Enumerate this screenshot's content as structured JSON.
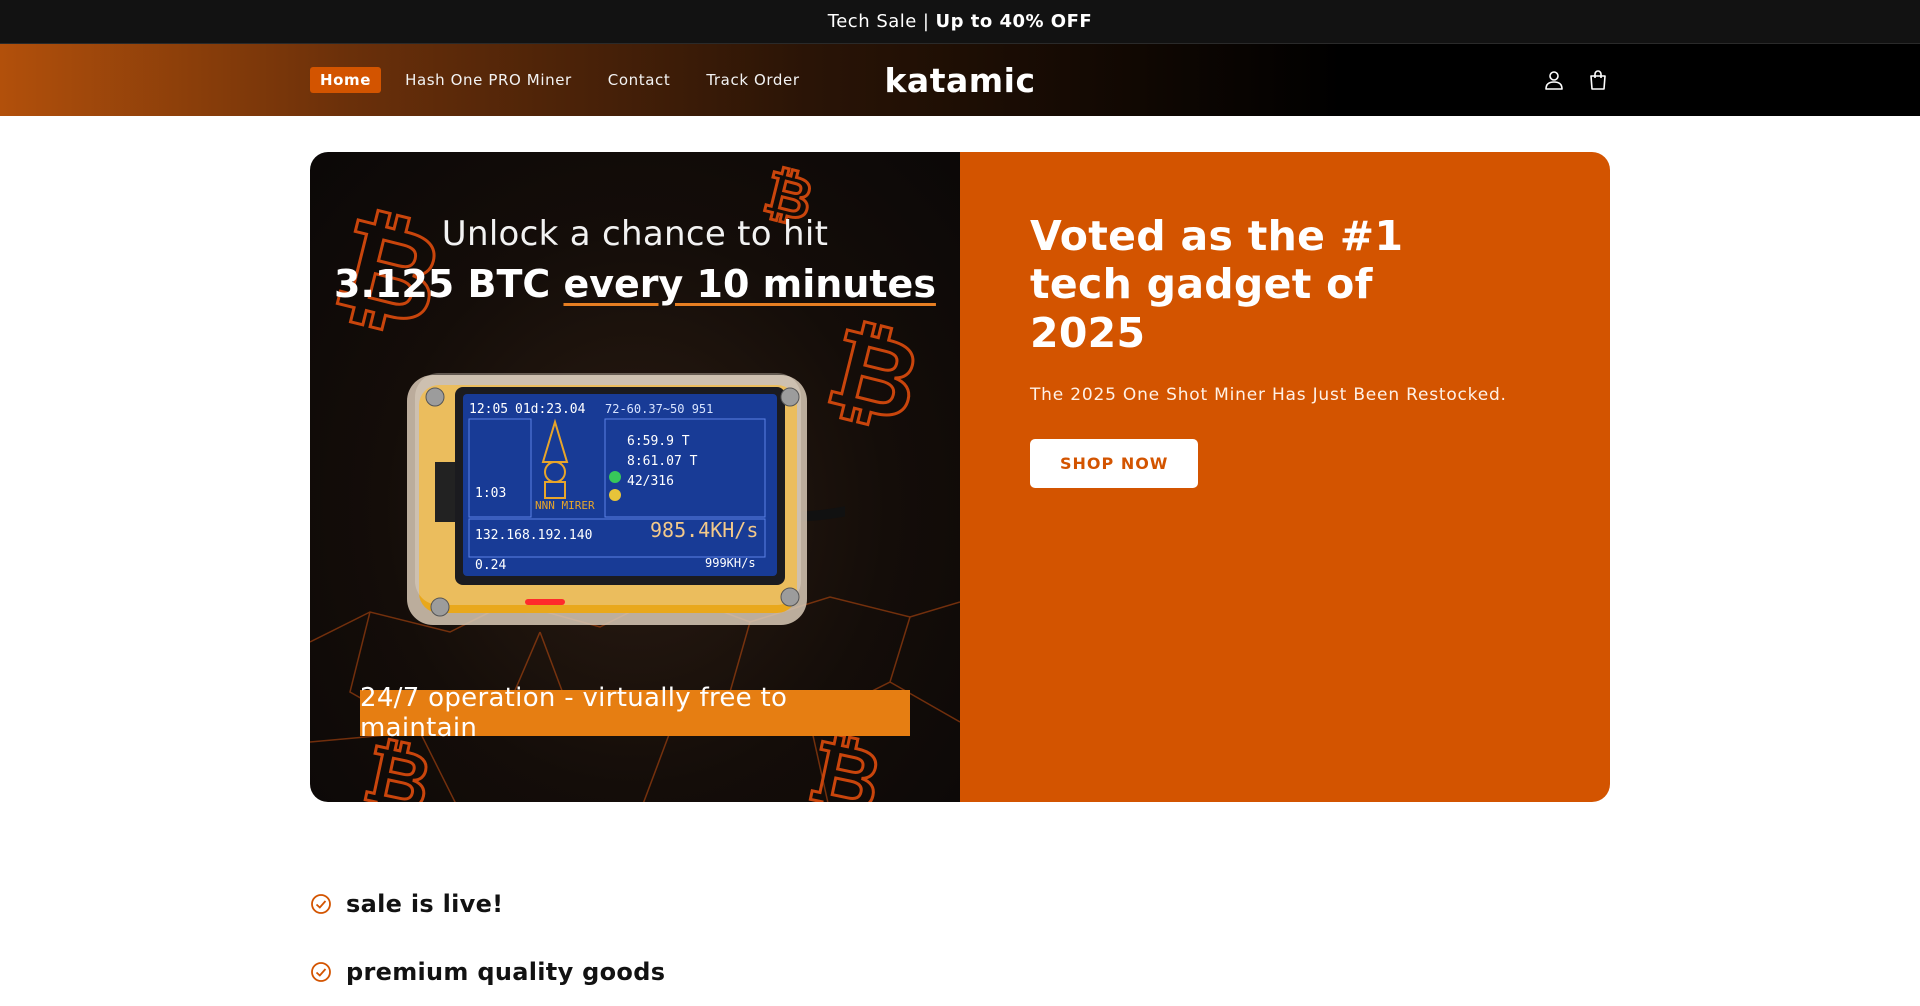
{
  "announcement": {
    "text": "Tech Sale",
    "separator": "|",
    "highlight": "Up to 40% OFF"
  },
  "header": {
    "logo": "katamic",
    "nav": [
      {
        "label": "Home",
        "active": true
      },
      {
        "label": "Hash One PRO Miner",
        "active": false
      },
      {
        "label": "Contact",
        "active": false
      },
      {
        "label": "Track Order",
        "active": false
      }
    ],
    "icons": [
      "account-icon",
      "cart-icon"
    ]
  },
  "hero": {
    "image": {
      "headline_line1": "Unlock a chance to hit",
      "headline_line2_a": "3.125 BTC",
      "headline_line2_b": "every 10 minutes",
      "banner": "24/7 operation - virtually free to maintain",
      "screen": {
        "time": "12:05",
        "uptime": "01d:23.04",
        "status": "72-60.37~50 951",
        "app": "NNN MIRER",
        "counter": "1:03",
        "stat1": "6:59.9 T",
        "stat2": "8:61.07 T",
        "stat3": "42/316",
        "ip": "132.168.192.140",
        "hashrate": "985.4KH/s",
        "value": "0.24",
        "best": "999KH/s"
      }
    },
    "title": "Voted as the #1 tech gadget of 2025",
    "subtitle": "The 2025 One Shot Miner Has Just Been Restocked.",
    "cta": "SHOP NOW"
  },
  "features": [
    {
      "text": "sale is live!"
    },
    {
      "text": "premium quality goods"
    }
  ],
  "colors": {
    "accent": "#d35400",
    "announcement_bg": "#121212",
    "header_bg": "#000000"
  }
}
